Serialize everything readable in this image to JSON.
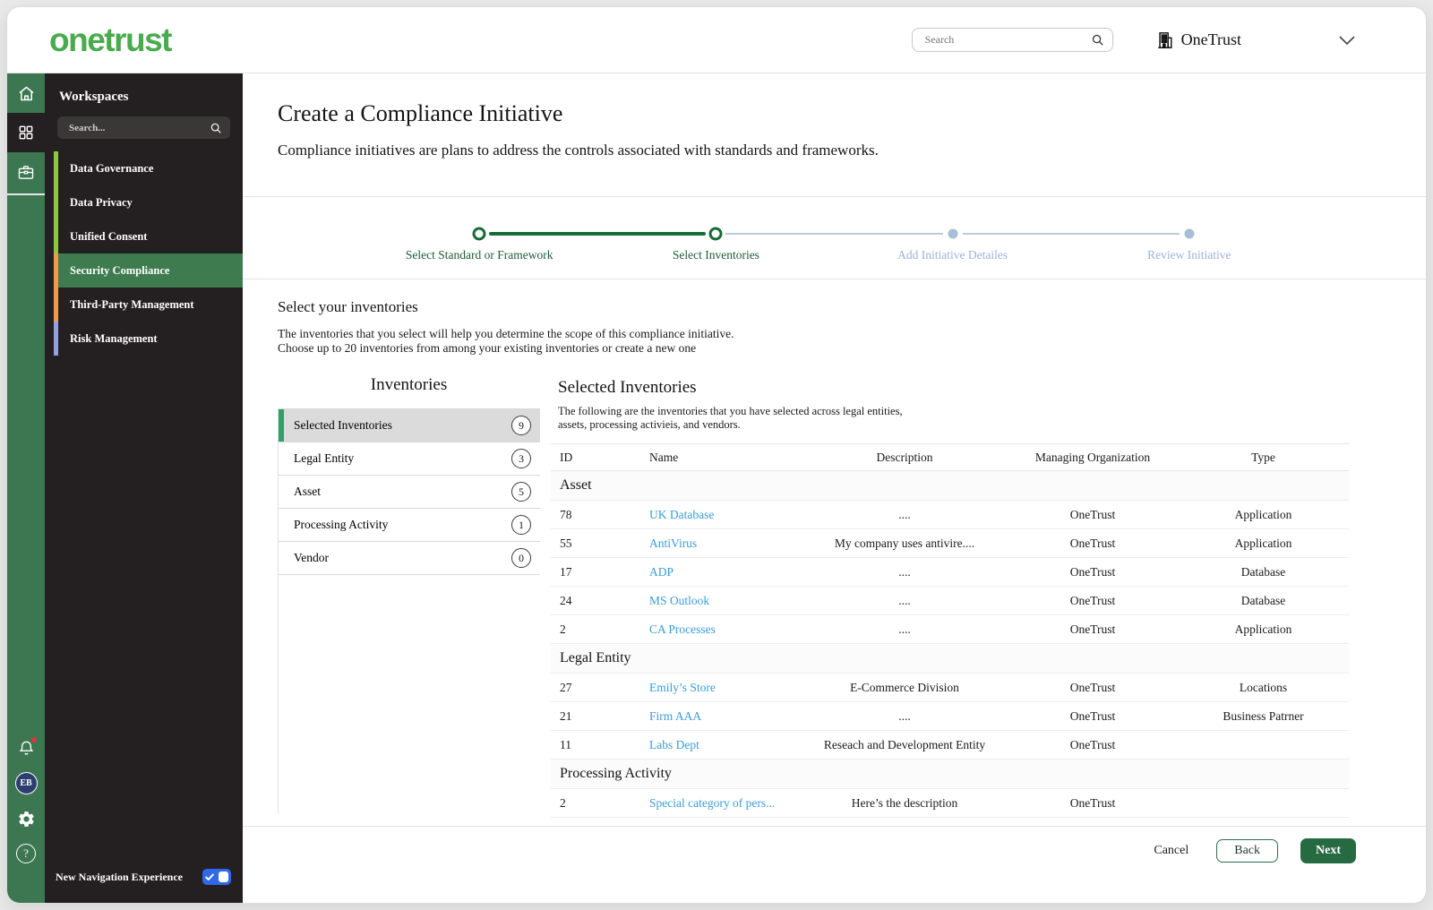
{
  "app": {
    "logo_text": "onetrust"
  },
  "header": {
    "search_placeholder": "Search",
    "org_name": "OneTrust"
  },
  "rail": {
    "avatar_initials": "EB",
    "help_glyph": "?"
  },
  "sidebar": {
    "title": "Workspaces",
    "search_placeholder": "Search...",
    "items": [
      {
        "label": "Data Governance",
        "accent": "#8dc63f",
        "selected": false
      },
      {
        "label": "Data Privacy",
        "accent": "#8dc63f",
        "selected": false
      },
      {
        "label": "Unified Consent",
        "accent": "#8dc63f",
        "selected": false
      },
      {
        "label": "Security Compliance",
        "accent": "#f09a4f",
        "selected": true
      },
      {
        "label": "Third-Party Management",
        "accent": "#f09a4f",
        "selected": false
      },
      {
        "label": "Risk Management",
        "accent": "#93a1e0",
        "selected": false
      }
    ],
    "footer_toggle_label": "New Navigation Experience"
  },
  "wizard": {
    "title": "Create a Compliance Initiative",
    "subtitle": "Compliance initiatives are plans to address the controls associated with standards and frameworks.",
    "steps": [
      {
        "label": "Select Standard or Framework",
        "state": "complete"
      },
      {
        "label": "Select Inventories",
        "state": "current"
      },
      {
        "label": "Add Initiative Detailes",
        "state": "upcoming"
      },
      {
        "label": "Review Initiative",
        "state": "upcoming"
      }
    ]
  },
  "section": {
    "heading": "Select your inventories",
    "description_line1": "The inventories that you select will help you determine the scope of this compliance initiative.",
    "description_line2": "Choose up to 20 inventories from among your existing inventories or create a new one"
  },
  "inventories_panel": {
    "title": "Inventories",
    "items": [
      {
        "label": "Selected Inventories",
        "count": "9",
        "selected": true
      },
      {
        "label": "Legal Entity",
        "count": "3",
        "selected": false
      },
      {
        "label": "Asset",
        "count": "5",
        "selected": false
      },
      {
        "label": "Processing Activity",
        "count": "1",
        "selected": false
      },
      {
        "label": "Vendor",
        "count": "0",
        "selected": false
      }
    ]
  },
  "selected_panel": {
    "title": "Selected Inventories",
    "description_line1": "The following are the inventories that you have selected across legal entities,",
    "description_line2": "assets, processing activieis, and vendors.",
    "table": {
      "columns": [
        "ID",
        "Name",
        "Description",
        "Managing Organization",
        "Type"
      ],
      "groups": [
        {
          "name": "Asset",
          "rows": [
            {
              "id": "78",
              "name": "UK Database",
              "description": "....",
              "org": "OneTrust",
              "type": "Application"
            },
            {
              "id": "55",
              "name": "AntiVirus",
              "description": "My company uses antivire....",
              "org": "OneTrust",
              "type": "Application"
            },
            {
              "id": "17",
              "name": "ADP",
              "description": "....",
              "org": "OneTrust",
              "type": "Database"
            },
            {
              "id": "24",
              "name": "MS Outlook",
              "description": "....",
              "org": "OneTrust",
              "type": "Database"
            },
            {
              "id": "2",
              "name": "CA Processes",
              "description": "....",
              "org": "OneTrust",
              "type": "Application"
            }
          ]
        },
        {
          "name": "Legal Entity",
          "rows": [
            {
              "id": "27",
              "name": "Emily’s Store",
              "description": "E-Commerce Division",
              "org": "OneTrust",
              "type": "Locations"
            },
            {
              "id": "21",
              "name": "Firm AAA",
              "description": "....",
              "org": "OneTrust",
              "type": "Business Patrner"
            },
            {
              "id": "11",
              "name": "Labs Dept",
              "description": "Reseach and Development Entity",
              "org": "OneTrust",
              "type": ""
            }
          ]
        },
        {
          "name": "Processing Activity",
          "rows": [
            {
              "id": "2",
              "name": "Special category of pers...",
              "description": "Here’s the description",
              "org": "OneTrust",
              "type": ""
            }
          ]
        }
      ]
    }
  },
  "footer": {
    "cancel_label": "Cancel",
    "back_label": "Back",
    "next_label": "Next"
  },
  "colors": {
    "brand_green": "#4aab4e",
    "rail_green": "#3d7752",
    "selected_workspace_green": "#3e7b4e",
    "stepper_active_green": "#176b38",
    "stepper_inactive": "#a7bed6",
    "link_blue": "#3b9cd8",
    "toggle_blue": "#2e6ae8",
    "next_button_green": "#266a41"
  }
}
